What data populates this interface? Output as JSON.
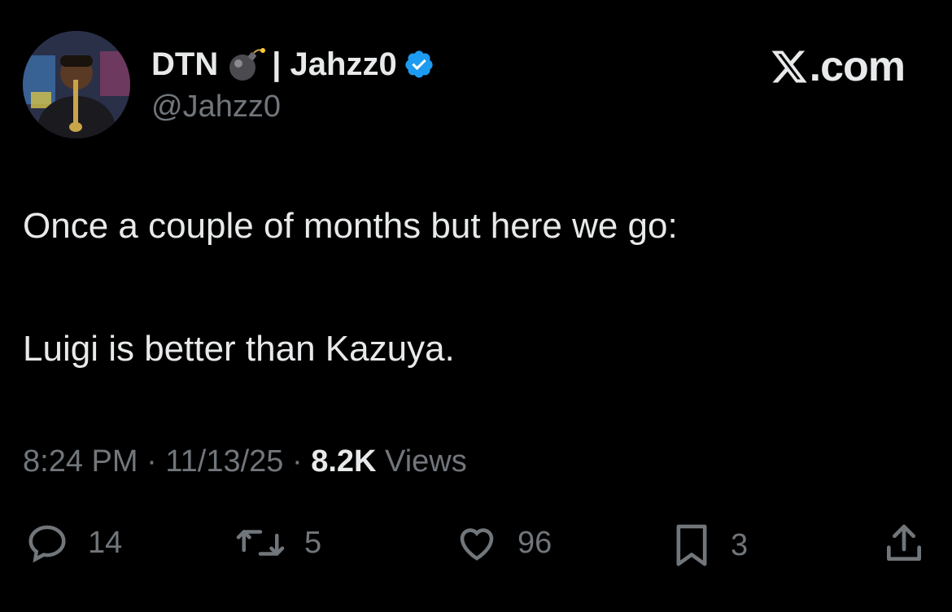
{
  "author": {
    "display_name_prefix": "DTN",
    "emoji": "bomb-icon",
    "display_name_suffix": "| Jahzz0",
    "handle": "@Jahzz0",
    "verified_badge": "verified-badge-icon",
    "verified_color": "#1d9bf0"
  },
  "brand": {
    "label": "com",
    "dot": "."
  },
  "tweet": {
    "line1": "Once a couple of months but here we go:",
    "line2": "Luigi is better than Kazuya."
  },
  "meta": {
    "time": "8:24 PM",
    "sep1": "·",
    "date": "11/13/25",
    "sep2": "·",
    "views_count": "8.2K",
    "views_label": "Views"
  },
  "actions": {
    "replies": "14",
    "reposts": "5",
    "likes": "96",
    "bookmarks": "3"
  },
  "icons": [
    "reply-icon",
    "repost-icon",
    "like-icon",
    "bookmark-icon",
    "share-icon"
  ]
}
